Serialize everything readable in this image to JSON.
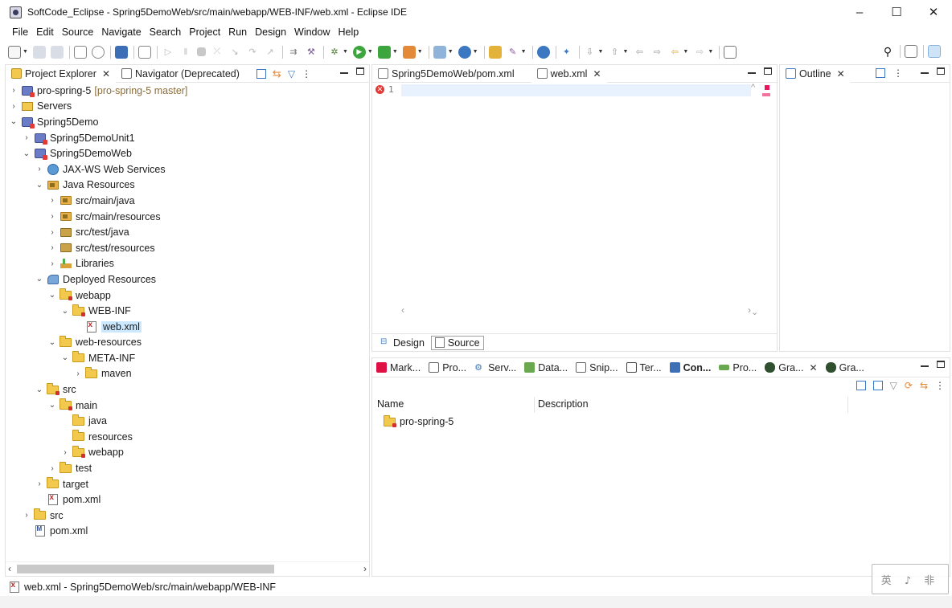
{
  "window": {
    "title": "SoftCode_Eclipse - Spring5DemoWeb/src/main/webapp/WEB-INF/web.xml - Eclipse IDE",
    "minimize": "–",
    "maximize": "☐",
    "close": "✕"
  },
  "menu": [
    "File",
    "Edit",
    "Source",
    "Navigate",
    "Search",
    "Project",
    "Run",
    "Design",
    "Window",
    "Help"
  ],
  "left_panel": {
    "tabs": [
      {
        "label": "Project Explorer",
        "active": true,
        "close": "✕"
      },
      {
        "label": "Navigator (Deprecated)",
        "active": false
      }
    ],
    "tree": [
      {
        "label": "pro-spring-5",
        "suffix": "[pro-spring-5 master]",
        "twisty": "›"
      },
      {
        "label": "Servers",
        "twisty": "›"
      },
      {
        "label": "Spring5Demo",
        "twisty": "⌄"
      },
      {
        "label": "Spring5DemoUnit1",
        "twisty": "›"
      },
      {
        "label": "Spring5DemoWeb",
        "twisty": "⌄"
      },
      {
        "label": "JAX-WS Web Services",
        "twisty": "›"
      },
      {
        "label": "Java Resources",
        "twisty": "⌄"
      },
      {
        "label": "src/main/java",
        "twisty": "›"
      },
      {
        "label": "src/main/resources",
        "twisty": "›"
      },
      {
        "label": "src/test/java",
        "twisty": "›"
      },
      {
        "label": "src/test/resources",
        "twisty": "›"
      },
      {
        "label": "Libraries",
        "twisty": "›"
      },
      {
        "label": "Deployed Resources",
        "twisty": "⌄"
      },
      {
        "label": "webapp",
        "twisty": "⌄"
      },
      {
        "label": "WEB-INF",
        "twisty": "⌄"
      },
      {
        "label": "web.xml",
        "twisty": ""
      },
      {
        "label": "web-resources",
        "twisty": "⌄"
      },
      {
        "label": "META-INF",
        "twisty": "⌄"
      },
      {
        "label": "maven",
        "twisty": "›"
      },
      {
        "label": "src",
        "twisty": "⌄"
      },
      {
        "label": "main",
        "twisty": "⌄"
      },
      {
        "label": "java",
        "twisty": ""
      },
      {
        "label": "resources",
        "twisty": ""
      },
      {
        "label": "webapp",
        "twisty": "›"
      },
      {
        "label": "test",
        "twisty": "›"
      },
      {
        "label": "target",
        "twisty": "›"
      },
      {
        "label": "pom.xml",
        "twisty": ""
      },
      {
        "label": "src",
        "twisty": "›"
      },
      {
        "label": "pom.xml",
        "twisty": ""
      }
    ],
    "scroll_left": "‹",
    "scroll_right": "›"
  },
  "editor": {
    "tabs": [
      {
        "label": "Spring5DemoWeb/pom.xml",
        "active": false
      },
      {
        "label": "web.xml",
        "active": true,
        "close": "✕"
      }
    ],
    "line_number": "1",
    "error_badge": "✕",
    "bottom_tabs": [
      "Design",
      "Source"
    ],
    "scroll_up": "^",
    "scroll_down": "⌄",
    "scroll_left": "‹",
    "scroll_right": "›"
  },
  "outline": {
    "tab": "Outline",
    "close": "✕"
  },
  "bottom_panel": {
    "tabs": [
      "Mark...",
      "Pro...",
      "Serv...",
      "Data...",
      "Snip...",
      "Ter...",
      "Con...",
      "Pro...",
      "Gra...",
      "Gra..."
    ],
    "active_close": "✕",
    "columns": [
      "Name",
      "Description"
    ],
    "rows": [
      {
        "name": "pro-spring-5",
        "description": ""
      }
    ]
  },
  "statusbar": {
    "text": "web.xml - Spring5DemoWeb/src/main/webapp/WEB-INF"
  },
  "watermark": {
    "text": "英 ♪ 非"
  },
  "colors": {
    "accent": "#0078d7",
    "selection": "#cce8ff",
    "error": "#e53935"
  }
}
